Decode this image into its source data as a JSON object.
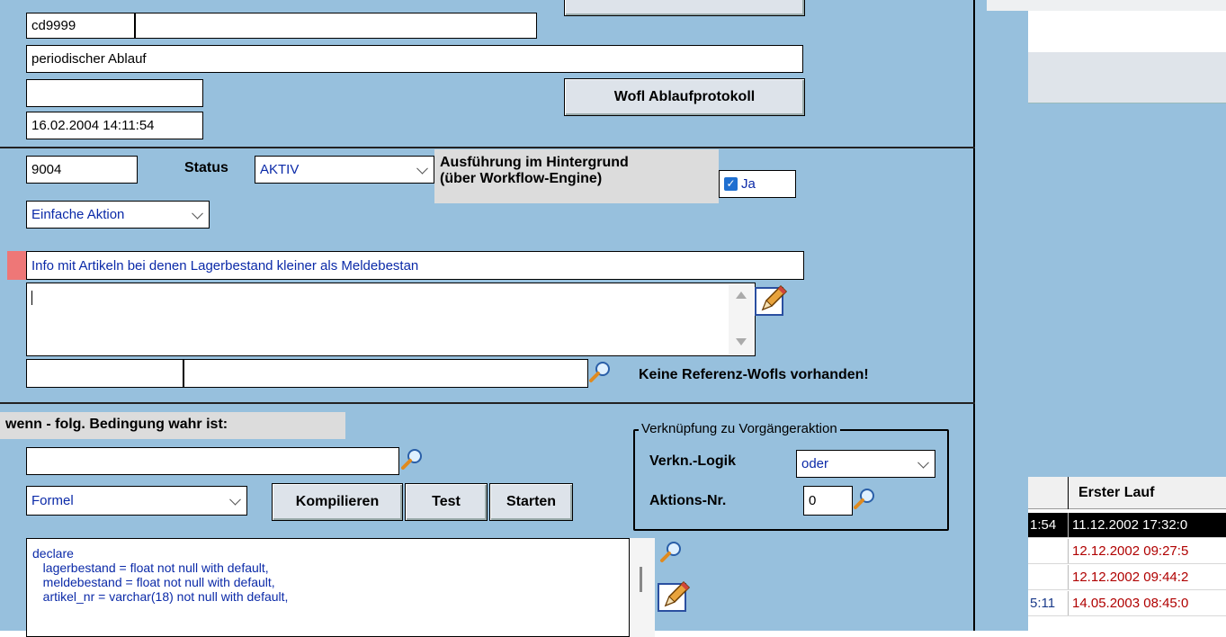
{
  "header": {
    "code": "cd9999",
    "description": "periodischer Ablauf",
    "date": "16.02.2004 14:11:54",
    "protocol_button": "Wofl Ablaufprotokoll"
  },
  "action": {
    "id": "9004",
    "status_label": "Status",
    "status_value": "AKTIV",
    "background_label_line1": "Ausführung im Hintergrund",
    "background_label_line2": "(über Workflow-Engine)",
    "background_checkbox_label": "Ja",
    "type_value": "Einfache Aktion",
    "info_text": "Info mit Artikeln bei denen Lagerbestand kleiner als Meldebestan",
    "memo_text": "",
    "no_refs_text": "Keine Referenz-Wofls vorhanden!"
  },
  "condition": {
    "title": "wenn  - folg. Bedingung wahr ist:",
    "mode_value": "Formel",
    "compile_button": "Kompilieren",
    "test_button": "Test",
    "start_button": "Starten",
    "code_lines": [
      "declare",
      "   lagerbestand = float not null with default,",
      "   meldebestand = float not null with default,",
      "   artikel_nr = varchar(18) not null with default,"
    ]
  },
  "link": {
    "group_title": "Verknüpfung zu Vorgängeraktion",
    "logic_label": "Verkn.-Logik",
    "logic_value": "oder",
    "action_nr_label": "Aktions-Nr.",
    "action_nr_value": "0"
  },
  "grid": {
    "header": "Erster Lauf",
    "rows": [
      {
        "c1": "1:54",
        "c2": "11.12.2002 17:32:0",
        "selected": true
      },
      {
        "c1": "",
        "c2": "12.12.2002 09:27:5",
        "selected": false
      },
      {
        "c1": "",
        "c2": "12.12.2002 09:44:2",
        "selected": false
      },
      {
        "c1": "5:11",
        "c2": "14.05.2003 08:45:0",
        "selected": false
      }
    ]
  },
  "colors": {
    "panel": "#97c0dd",
    "accent_red": "#ee7777",
    "blue_text": "#0b2aa8",
    "grid_red_text": "#b00000",
    "grid_selected_bg": "#000000"
  }
}
